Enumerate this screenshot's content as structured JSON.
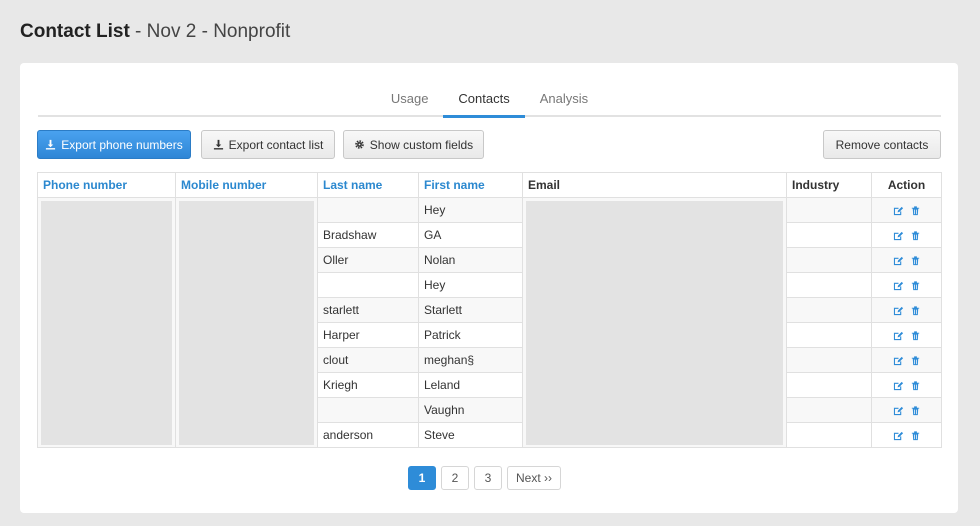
{
  "page": {
    "title": "Contact List",
    "separator": " - ",
    "subtitle": "Nov 2 - Nonprofit"
  },
  "tabs": [
    {
      "label": "Usage",
      "active": false
    },
    {
      "label": "Contacts",
      "active": true
    },
    {
      "label": "Analysis",
      "active": false
    }
  ],
  "toolbar": {
    "export_phone_label": "Export phone numbers",
    "export_contacts_label": "Export contact list",
    "custom_fields_label": "Show custom fields",
    "remove_label": "Remove contacts"
  },
  "table": {
    "headers": {
      "phone": "Phone number",
      "mobile": "Mobile number",
      "last": "Last name",
      "first": "First name",
      "email": "Email",
      "industry": "Industry",
      "action": "Action"
    },
    "rows": [
      {
        "last": "",
        "first": "Hey",
        "industry": ""
      },
      {
        "last": "Bradshaw",
        "first": "GA",
        "industry": ""
      },
      {
        "last": "Oller",
        "first": "Nolan",
        "industry": ""
      },
      {
        "last": "",
        "first": "Hey",
        "industry": ""
      },
      {
        "last": "starlett",
        "first": "Starlett",
        "industry": ""
      },
      {
        "last": "Harper",
        "first": "Patrick",
        "industry": ""
      },
      {
        "last": "clout",
        "first": "meghan§",
        "industry": ""
      },
      {
        "last": "Kriegh",
        "first": "Leland",
        "industry": ""
      },
      {
        "last": "",
        "first": "Vaughn",
        "industry": ""
      },
      {
        "last": "anderson",
        "first": "Steve",
        "industry": ""
      }
    ]
  },
  "pagination": {
    "pages": [
      "1",
      "2",
      "3"
    ],
    "current": "1",
    "next_label": "Next ››"
  },
  "icons": {
    "download": "download-icon",
    "gear": "gear-icon",
    "edit": "edit-icon",
    "delete": "trash-icon"
  },
  "colors": {
    "accent": "#2e8cd8",
    "header_link": "#2b88cf",
    "redacted": "#e3e3e3"
  }
}
